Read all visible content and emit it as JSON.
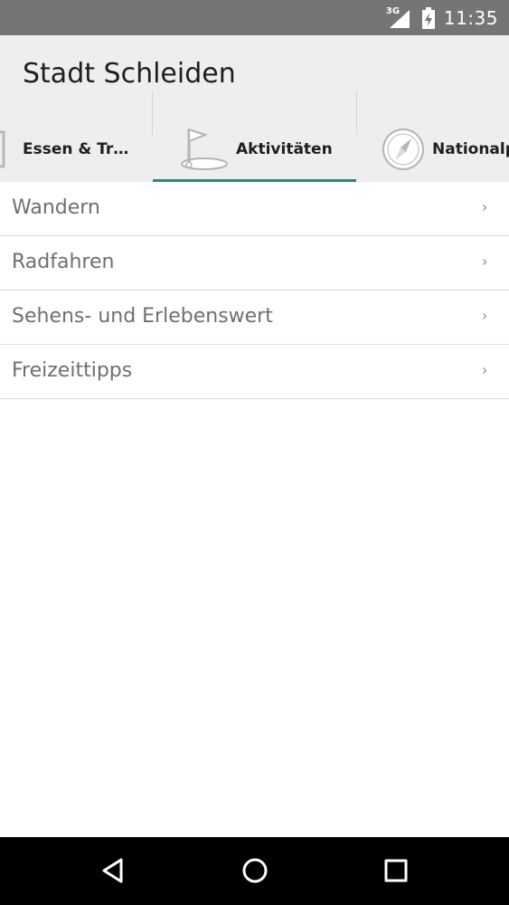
{
  "status_bar": {
    "network_label": "3G",
    "time": "11:35"
  },
  "app_bar": {
    "title": "Stadt Schleiden"
  },
  "tabs": [
    {
      "label": "Essen & Tr…",
      "icon": "restaurant-icon"
    },
    {
      "label": "Aktivitäten",
      "icon": "golf-flag-icon",
      "selected": true
    },
    {
      "label": "Nationalpark",
      "icon": "compass-icon"
    }
  ],
  "list": {
    "items": [
      {
        "label": "Wandern"
      },
      {
        "label": "Radfahren"
      },
      {
        "label": "Sehens- und Erlebenswert"
      },
      {
        "label": "Freizeittipps"
      }
    ]
  },
  "colors": {
    "accent": "#1a9278",
    "status_bar": "#757575",
    "app_bar": "#eeeef0"
  }
}
